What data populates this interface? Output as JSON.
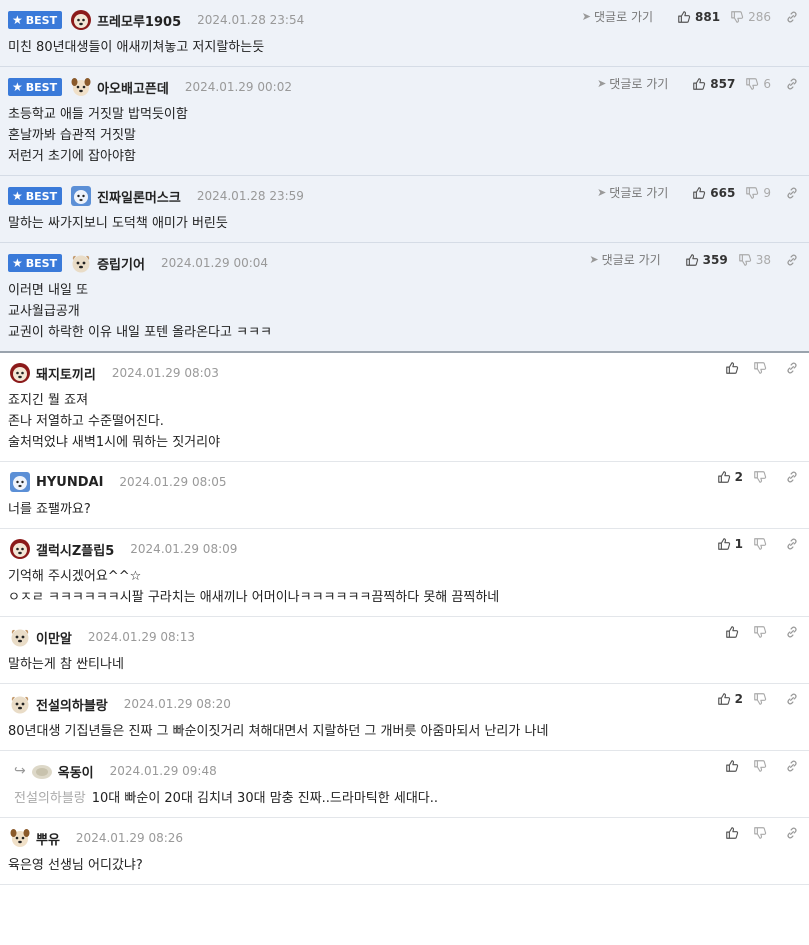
{
  "ui": {
    "best_label": "BEST",
    "goto_label": "댓글로 가기"
  },
  "comments": [
    {
      "nick": "프레모루1905",
      "date": "2024.01.28 23:54",
      "up": "881",
      "down": "286",
      "lines": [
        "미친 80년대생들이 애새끼쳐놓고 저지랄하는듯"
      ]
    },
    {
      "nick": "아오배고픈데",
      "date": "2024.01.29 00:02",
      "up": "857",
      "down": "6",
      "lines": [
        "초등학교 애들 거짓말 밥먹듯이함",
        "혼날까봐 습관적 거짓말",
        "저런거 초기에 잡아야함"
      ]
    },
    {
      "nick": "진짜일론머스크",
      "date": "2024.01.28 23:59",
      "up": "665",
      "down": "9",
      "lines": [
        "말하는 싸가지보니 도덕책 애미가 버린듯"
      ]
    },
    {
      "nick": "증립기어",
      "date": "2024.01.29 00:04",
      "up": "359",
      "down": "38",
      "lines": [
        "이러면 내일 또",
        "교사월급공개",
        "교권이 하락한 이유 내일 포텐 올라온다고 ㅋㅋㅋ"
      ]
    },
    {
      "nick": "돼지토끼리",
      "date": "2024.01.29 08:03",
      "up": "",
      "down": "",
      "lines": [
        "죠지긴 뭘 죠져",
        "존나 저열하고 수준떨어진다.",
        "술처먹었냐 새벽1시에 뭐하는 짓거리야"
      ]
    },
    {
      "nick": "HYUNDAI",
      "date": "2024.01.29 08:05",
      "up": "2",
      "down": "",
      "lines": [
        "너를 죠팰까요?"
      ]
    },
    {
      "nick": "갤럭시Z플립5",
      "date": "2024.01.29 08:09",
      "up": "1",
      "down": "",
      "lines": [
        "기억해 주시겠어요^^☆",
        "ㅇㅈㄹ ㅋㅋㅋㅋㅋㅋ시팔 구라치는 애새끼나 어머이나ㅋㅋㅋㅋㅋㅋ끔찍하다 못해 끔찍하네"
      ]
    },
    {
      "nick": "이만알",
      "date": "2024.01.29 08:13",
      "up": "",
      "down": "",
      "lines": [
        "말하는게 참 싼티나네"
      ]
    },
    {
      "nick": "전설의하블랑",
      "date": "2024.01.29 08:20",
      "up": "2",
      "down": "",
      "lines": [
        "80년대생 기집년들은 진짜 그 빠순이짓거리 쳐해대면서 지랄하던 그 개버릇 아줌마되서 난리가 나네"
      ]
    },
    {
      "nick": "옥동이",
      "date": "2024.01.29 09:48",
      "up": "",
      "down": "",
      "mention": "전설의하블랑",
      "lines": [
        "10대 빠순이 20대 김치녀 30대 맘충 진짜..드라마틱한 세대다.."
      ]
    },
    {
      "nick": "뿌유",
      "date": "2024.01.29 08:26",
      "up": "",
      "down": "",
      "lines": [
        "육은영 선생님 어디갔냐?"
      ]
    }
  ],
  "colors": {
    "best_bg": "#eef2f8",
    "badge": "#3a7ad9"
  }
}
